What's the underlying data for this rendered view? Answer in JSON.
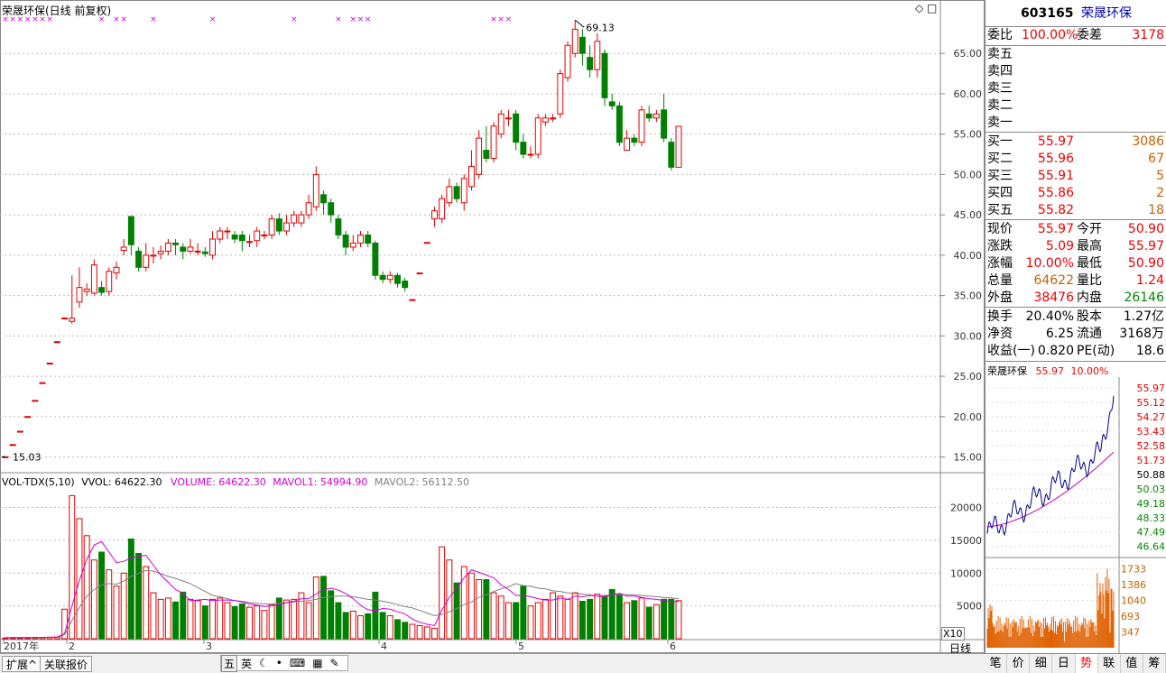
{
  "chart_header": {
    "title": "荣晟环保(日线 前复权)",
    "diamond_icon": "◇",
    "box_icon": "□"
  },
  "volume_header": {
    "indicator": "VOL-TDX(5,10)",
    "vvol": "VVOL: 64622.30",
    "volume": "VOLUME: 64622.30",
    "mavol1": "MAVOL1: 54994.90",
    "mavol2": "MAVOL2: 56112.50"
  },
  "chart_data": [
    {
      "type": "candlestick",
      "title": "荣晟环保(日线 前复权)",
      "y_ticks": [
        "65.00",
        "60.00",
        "55.00",
        "50.00",
        "45.00",
        "40.00",
        "35.00",
        "30.00",
        "25.00",
        "20.00",
        "15.00"
      ],
      "ylim": [
        13.5,
        70.5
      ],
      "x_ticks": [
        "2017年",
        "2",
        "3",
        "4",
        "5",
        "6"
      ],
      "annotations": {
        "high": "69.13",
        "low": "15.03"
      },
      "candles": [
        [
          15.03,
          15.03,
          15.03,
          15.03
        ],
        [
          16.54,
          16.54,
          16.54,
          16.54
        ],
        [
          18.19,
          18.19,
          18.19,
          18.19
        ],
        [
          20.01,
          20.01,
          20.01,
          20.01
        ],
        [
          22.01,
          22.01,
          22.01,
          22.01
        ],
        [
          24.21,
          24.21,
          24.21,
          24.21
        ],
        [
          26.63,
          26.63,
          26.63,
          26.63
        ],
        [
          29.29,
          29.29,
          29.29,
          29.29
        ],
        [
          32.22,
          32.22,
          32.22,
          32.22
        ],
        [
          31.8,
          32.2,
          37.5,
          31.5
        ],
        [
          34.2,
          36.0,
          38.5,
          33.5
        ],
        [
          35.5,
          35.8,
          36.5,
          35.0
        ],
        [
          35.3,
          38.8,
          39.5,
          35.0
        ],
        [
          36.0,
          35.4,
          36.8,
          35.0
        ],
        [
          35.5,
          38.0,
          38.5,
          35.0
        ],
        [
          37.8,
          38.5,
          39.2,
          37.0
        ],
        [
          40.6,
          41.0,
          42.0,
          40.0
        ],
        [
          44.8,
          41.3,
          44.8,
          40.0
        ],
        [
          40.5,
          38.5,
          41.0,
          38.0
        ],
        [
          38.5,
          40.0,
          41.5,
          38.0
        ],
        [
          40.0,
          40.0,
          41.0,
          39.0
        ],
        [
          40.2,
          40.5,
          41.2,
          39.5
        ],
        [
          40.5,
          41.5,
          42.0,
          40.0
        ],
        [
          41.5,
          41.3,
          42.0,
          40.0
        ],
        [
          41.0,
          40.5,
          41.5,
          39.5
        ],
        [
          40.5,
          41.0,
          42.0,
          40.2
        ],
        [
          40.5,
          40.5,
          41.5,
          40.0
        ],
        [
          40.4,
          40.2,
          41.0,
          39.8
        ],
        [
          40.0,
          42.0,
          43.0,
          39.5
        ],
        [
          42.0,
          43.0,
          43.5,
          41.5
        ],
        [
          43.0,
          43.0,
          43.5,
          42.0
        ],
        [
          42.5,
          42.0,
          43.0,
          41.5
        ],
        [
          42.5,
          41.8,
          43.0,
          40.5
        ],
        [
          41.7,
          41.7,
          42.5,
          41.0
        ],
        [
          41.8,
          43.0,
          43.5,
          41.0
        ],
        [
          42.5,
          42.5,
          43.0,
          42.0
        ],
        [
          42.5,
          44.5,
          45.0,
          42.0
        ],
        [
          44.5,
          43.0,
          45.2,
          42.5
        ],
        [
          43.0,
          44.0,
          45.0,
          42.5
        ],
        [
          44.0,
          45.0,
          45.5,
          43.5
        ],
        [
          44.0,
          45.0,
          45.5,
          43.5
        ],
        [
          45.0,
          46.5,
          47.5,
          44.5
        ],
        [
          46.0,
          50.0,
          51.0,
          45.5
        ],
        [
          47.5,
          46.5,
          48.0,
          45.0
        ],
        [
          46.5,
          45.0,
          47.0,
          44.0
        ],
        [
          44.5,
          42.5,
          45.0,
          42.0
        ],
        [
          42.5,
          41.0,
          43.0,
          40.0
        ],
        [
          41.0,
          41.5,
          42.5,
          40.5
        ],
        [
          41.5,
          42.5,
          43.0,
          41.0
        ],
        [
          42.5,
          41.5,
          43.0,
          41.0
        ],
        [
          41.5,
          37.5,
          41.8,
          37.0
        ],
        [
          37.5,
          37.0,
          38.0,
          36.5
        ],
        [
          37.0,
          37.5,
          38.0,
          36.5
        ],
        [
          37.5,
          36.5,
          37.8,
          36.0
        ],
        [
          36.8,
          36.0,
          37.2,
          35.5
        ],
        [
          34.5,
          34.5,
          34.5,
          34.5
        ],
        [
          37.8,
          37.8,
          37.8,
          37.8
        ],
        [
          41.58,
          41.58,
          41.58,
          41.58
        ],
        [
          44.5,
          45.5,
          46.0,
          43.5
        ],
        [
          44.5,
          47.0,
          47.5,
          44.0
        ],
        [
          46.5,
          48.5,
          49.5,
          46.0
        ],
        [
          48.5,
          47.0,
          49.0,
          46.5
        ],
        [
          46.5,
          49.5,
          50.0,
          45.5
        ],
        [
          48.5,
          51.0,
          53.0,
          48.0
        ],
        [
          50.0,
          54.5,
          55.5,
          49.5
        ],
        [
          53.0,
          52.0,
          56.0,
          51.5
        ],
        [
          52.0,
          56.0,
          56.5,
          51.5
        ],
        [
          55.0,
          57.5,
          58.0,
          54.5
        ],
        [
          57.0,
          57.0,
          58.0,
          56.0
        ],
        [
          57.5,
          54.0,
          58.0,
          53.0
        ],
        [
          54.0,
          52.5,
          55.0,
          52.0
        ],
        [
          52.5,
          52.5,
          53.5,
          52.0
        ],
        [
          52.5,
          57.0,
          57.5,
          52.0
        ],
        [
          56.5,
          57.0,
          57.5,
          56.0
        ],
        [
          57.0,
          57.0,
          57.5,
          56.5
        ],
        [
          57.5,
          62.5,
          63.0,
          57.0
        ],
        [
          62.0,
          66.0,
          66.5,
          61.5
        ],
        [
          65.0,
          68.0,
          69.13,
          64.5
        ],
        [
          67.0,
          65.0,
          68.0,
          63.5
        ],
        [
          64.5,
          63.0,
          66.0,
          62.0
        ],
        [
          63.0,
          66.5,
          67.5,
          62.0
        ],
        [
          65.0,
          59.5,
          65.5,
          58.5
        ],
        [
          59.0,
          58.5,
          60.0,
          58.0
        ],
        [
          58.5,
          54.0,
          59.0,
          53.5
        ],
        [
          53.0,
          54.5,
          55.5,
          53.0
        ],
        [
          54.5,
          54.0,
          55.0,
          53.5
        ],
        [
          54.0,
          58.0,
          58.5,
          53.5
        ],
        [
          57.5,
          57.0,
          58.5,
          56.5
        ],
        [
          57.0,
          57.5,
          58.0,
          56.5
        ],
        [
          58.0,
          54.5,
          60.0,
          54.0
        ],
        [
          54.0,
          50.9,
          54.5,
          50.5
        ],
        [
          50.9,
          55.97,
          55.97,
          50.9
        ]
      ],
      "signal_markers": [
        0,
        1,
        2,
        3,
        4,
        5,
        6,
        13,
        15,
        16,
        20,
        28,
        39,
        45,
        47,
        48,
        49,
        66,
        67,
        68,
        94,
        106
      ]
    },
    {
      "type": "bar",
      "title": "VOL-TDX(5,10)",
      "y_ticks": [
        "20000",
        "15000",
        "10000",
        "5000"
      ],
      "ylim": [
        0,
        22000
      ],
      "volumes": [
        120,
        140,
        150,
        160,
        180,
        200,
        210,
        260,
        4500,
        21800,
        18300,
        15700,
        12000,
        13200,
        10500,
        8000,
        10000,
        15200,
        13000,
        11000,
        7000,
        6000,
        6200,
        5600,
        7100,
        6000,
        5800,
        5000,
        6000,
        6200,
        5500,
        4900,
        5300,
        4800,
        5000,
        4300,
        5200,
        6200,
        5900,
        6000,
        7000,
        5500,
        9400,
        9500,
        7300,
        5500,
        4000,
        4200,
        3500,
        3800,
        7100,
        4000,
        3500,
        2900,
        2500,
        2200,
        2000,
        1800,
        1600,
        14000,
        12000,
        8500,
        11000,
        10000,
        9000,
        9000,
        7000,
        6500,
        5500,
        5500,
        8000,
        5000,
        5500,
        6000,
        7000,
        6500,
        6000,
        7000,
        5700,
        6000,
        6800,
        6500,
        7500,
        6800,
        5500,
        5800,
        6200,
        4800,
        5200,
        6000,
        6000,
        5800,
        6500
      ],
      "mavol1": [
        150,
        160,
        165,
        175,
        190,
        210,
        230,
        260,
        800,
        5000,
        8900,
        12100,
        14300,
        14800,
        13200,
        11600,
        11800,
        12300,
        12600,
        12700,
        11200,
        9700,
        8600,
        7500,
        6900,
        5800,
        5900,
        6000,
        5800,
        5900,
        5900,
        5800,
        5600,
        5300,
        5100,
        4900,
        5000,
        5200,
        5500,
        5700,
        6100,
        6100,
        6800,
        7500,
        7700,
        7400,
        6900,
        6100,
        5100,
        4400,
        4300,
        4600,
        4500,
        4100,
        3800,
        3000,
        2500,
        2200,
        2000,
        4400,
        6300,
        7700,
        9300,
        10500,
        10100,
        9700,
        9300,
        8200,
        7500,
        6600,
        6600,
        6400,
        6100,
        5900,
        5900,
        6200,
        6000,
        6500,
        6400,
        6600,
        6500,
        6400,
        6700,
        6900,
        6500,
        6500,
        6300,
        6100,
        6000,
        5800,
        5600,
        5700,
        6000
      ],
      "mavol2": [
        150,
        160,
        165,
        170,
        180,
        190,
        200,
        215,
        600,
        2800,
        4800,
        6500,
        7500,
        8200,
        8400,
        8300,
        8800,
        9500,
        10000,
        10400,
        10300,
        9900,
        9500,
        9200,
        8800,
        8400,
        7800,
        7200,
        6600,
        6400,
        6100,
        5800,
        5700,
        5500,
        5400,
        5300,
        5300,
        5400,
        5500,
        5600,
        5700,
        5800,
        6000,
        6300,
        6400,
        6500,
        6500,
        6400,
        6200,
        6000,
        5900,
        5700,
        5500,
        5200,
        4900,
        4700,
        4300,
        3900,
        3500,
        3700,
        4100,
        4600,
        5200,
        5600,
        6300,
        6700,
        7200,
        7600,
        7900,
        8400,
        8100,
        8000,
        7700,
        7600,
        7300,
        7200,
        7000,
        6900,
        6800,
        6700,
        6500,
        6600,
        6700,
        6700,
        6700,
        6700,
        6600,
        6500,
        6400,
        6300,
        6200,
        6100,
        6100
      ]
    },
    {
      "type": "line",
      "title": "荣晟环保 55.97 10.00%",
      "y_ticks": [
        "55.97",
        "55.12",
        "54.27",
        "53.43",
        "52.58",
        "51.73",
        "50.88",
        "50.03",
        "49.18",
        "48.33",
        "47.49",
        "46.64"
      ],
      "vol_ticks": [
        "1733",
        "1386",
        "1040",
        "693",
        "347"
      ],
      "ylim": [
        46.2,
        56.4
      ]
    }
  ],
  "quote": {
    "code": "603165",
    "name": "荣晟环保",
    "weibi_label": "委比",
    "weibi_val": "100.00%",
    "weicha_label": "委差",
    "weicha_val": "3178",
    "asks": [
      {
        "label": "卖五",
        "price": "",
        "vol": ""
      },
      {
        "label": "卖四",
        "price": "",
        "vol": ""
      },
      {
        "label": "卖三",
        "price": "",
        "vol": ""
      },
      {
        "label": "卖二",
        "price": "",
        "vol": ""
      },
      {
        "label": "卖一",
        "price": "",
        "vol": ""
      }
    ],
    "bids": [
      {
        "label": "买一",
        "price": "55.97",
        "vol": "3086"
      },
      {
        "label": "买二",
        "price": "55.96",
        "vol": "67"
      },
      {
        "label": "买三",
        "price": "55.91",
        "vol": "5"
      },
      {
        "label": "买四",
        "price": "55.86",
        "vol": "2"
      },
      {
        "label": "买五",
        "price": "55.82",
        "vol": "18"
      }
    ],
    "stats": [
      {
        "l1": "现价",
        "v1": "55.97",
        "c1": "red",
        "l2": "今开",
        "v2": "50.90",
        "c2": "red"
      },
      {
        "l1": "涨跌",
        "v1": "5.09",
        "c1": "red",
        "l2": "最高",
        "v2": "55.97",
        "c2": "red"
      },
      {
        "l1": "涨幅",
        "v1": "10.00%",
        "c1": "red",
        "l2": "最低",
        "v2": "50.90",
        "c2": "red"
      },
      {
        "l1": "总量",
        "v1": "64622",
        "c1": "orange",
        "l2": "量比",
        "v2": "1.24",
        "c2": "red"
      },
      {
        "l1": "外盘",
        "v1": "38476",
        "c1": "red",
        "l2": "内盘",
        "v2": "26146",
        "c2": "green"
      }
    ],
    "fund": [
      {
        "l1": "换手",
        "v1": "20.40%",
        "l2": "股本",
        "v2": "1.27亿"
      },
      {
        "l1": "净资",
        "v1": "6.25",
        "l2": "流通",
        "v2": "3168万"
      },
      {
        "l1": "收益(一)",
        "v1": "0.820",
        "l2": "PE(动)",
        "v2": "18.6"
      }
    ],
    "mini_title_name": "荣晟环保",
    "mini_title_price": "55.97",
    "mini_title_pct": "10.00%"
  },
  "x_axis": {
    "period": "日线",
    "x10": "X10"
  },
  "toolbar": {
    "expand": "扩展^",
    "link": "关联报价"
  },
  "ime": {
    "wu": "五",
    "ying": "英",
    "moon": "☾",
    "dot": "•",
    "kb": "⌨",
    "shirt": "▦",
    "wrench": "✎"
  },
  "tabs": [
    "笔",
    "价",
    "细",
    "日",
    "势",
    "联",
    "值",
    "筹"
  ],
  "colors": {
    "up": "#e00000",
    "down": "#008000",
    "ma1": "#d000d0",
    "ma2": "#808080",
    "mini_line": "#000080",
    "mini_avg": "#c000c0",
    "mini_vol": "#e06000"
  }
}
